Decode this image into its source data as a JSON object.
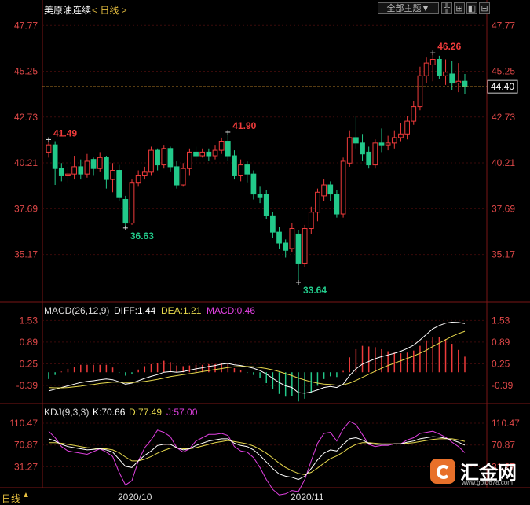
{
  "header": {
    "title": "美原油连续",
    "period": "< 日线 >",
    "theme_button": "全部主题▼"
  },
  "toolbar_buttons": [
    {
      "name": "crosshair-button",
      "glyph": "╬"
    },
    {
      "name": "zoom-in-button",
      "glyph": "⊞"
    },
    {
      "name": "prev-button",
      "glyph": "◧"
    },
    {
      "name": "next-button",
      "glyph": "⊟"
    }
  ],
  "colors": {
    "up": "#ef3b3b",
    "down": "#22c98a",
    "axis_text": "#e04848",
    "grid": "#3a0a0a",
    "diff_line": "#ffffff",
    "dea_line": "#e6d84c",
    "j_line": "#e040e0",
    "price_line": "#e8a030"
  },
  "footer": {
    "left_label": "日线",
    "x_labels": [
      "2020/10",
      "2020/11"
    ]
  },
  "logo": {
    "text": "汇金网",
    "url": "www.gold678.com"
  },
  "chart_data": [
    {
      "type": "candlestick",
      "name": "price",
      "y_ticks": [
        47.77,
        45.25,
        42.73,
        40.21,
        37.69,
        35.17
      ],
      "ylim": [
        32.6,
        48.3
      ],
      "current_price": 44.4,
      "annotations": [
        {
          "label": "41.49",
          "value": 41.49,
          "kind": "high",
          "index": 0
        },
        {
          "label": "36.63",
          "value": 36.63,
          "kind": "low",
          "index": 12
        },
        {
          "label": "41.90",
          "value": 41.9,
          "kind": "high",
          "index": 28
        },
        {
          "label": "33.64",
          "value": 33.64,
          "kind": "low",
          "index": 39
        },
        {
          "label": "46.26",
          "value": 46.26,
          "kind": "high",
          "index": 60
        }
      ],
      "candles": [
        [
          40.8,
          41.2,
          41.49,
          40.5
        ],
        [
          41.2,
          39.9,
          41.4,
          39.0
        ],
        [
          39.9,
          39.5,
          40.2,
          39.2
        ],
        [
          39.5,
          39.6,
          40.0,
          39.1
        ],
        [
          39.6,
          40.0,
          40.6,
          39.3
        ],
        [
          40.0,
          39.6,
          40.4,
          39.3
        ],
        [
          39.6,
          40.3,
          40.7,
          39.4
        ],
        [
          40.4,
          39.9,
          40.5,
          39.5
        ],
        [
          39.9,
          40.5,
          40.8,
          39.7
        ],
        [
          40.5,
          39.3,
          40.6,
          38.8
        ],
        [
          39.3,
          39.8,
          40.2,
          38.6
        ],
        [
          39.8,
          38.3,
          40.1,
          38.1
        ],
        [
          38.2,
          36.9,
          38.4,
          36.63
        ],
        [
          36.9,
          39.1,
          39.3,
          36.8
        ],
        [
          39.1,
          39.5,
          39.8,
          38.9
        ],
        [
          39.5,
          39.7,
          40.0,
          39.3
        ],
        [
          39.7,
          40.9,
          41.1,
          39.5
        ],
        [
          40.9,
          40.1,
          41.0,
          39.8
        ],
        [
          40.1,
          41.0,
          41.2,
          39.9
        ],
        [
          41.0,
          40.0,
          41.1,
          39.7
        ],
        [
          40.0,
          39.0,
          40.3,
          38.8
        ],
        [
          39.0,
          39.9,
          40.2,
          38.9
        ],
        [
          39.9,
          40.8,
          41.0,
          39.5
        ],
        [
          40.8,
          40.6,
          41.1,
          40.3
        ],
        [
          40.6,
          40.8,
          41.0,
          40.5
        ],
        [
          40.8,
          40.6,
          41.0,
          40.3
        ],
        [
          40.6,
          40.9,
          41.2,
          40.4
        ],
        [
          40.9,
          41.4,
          41.6,
          40.7
        ],
        [
          41.4,
          40.6,
          41.9,
          40.3
        ],
        [
          40.6,
          39.5,
          40.9,
          39.3
        ],
        [
          39.5,
          40.1,
          40.4,
          39.2
        ],
        [
          40.1,
          39.6,
          40.3,
          39.1
        ],
        [
          39.6,
          38.5,
          39.8,
          38.2
        ],
        [
          38.5,
          38.3,
          38.9,
          38.0
        ],
        [
          38.5,
          37.3,
          38.7,
          37.1
        ],
        [
          37.3,
          36.4,
          37.5,
          36.1
        ],
        [
          36.4,
          35.8,
          36.7,
          35.5
        ],
        [
          35.8,
          35.4,
          36.0,
          35.0
        ],
        [
          35.5,
          36.6,
          36.9,
          35.3
        ],
        [
          36.3,
          34.7,
          36.5,
          33.64
        ],
        [
          34.7,
          36.6,
          36.8,
          34.5
        ],
        [
          36.6,
          37.5,
          37.8,
          36.3
        ],
        [
          37.5,
          38.6,
          38.8,
          37.0
        ],
        [
          38.4,
          39.0,
          39.3,
          38.1
        ],
        [
          39.0,
          38.5,
          39.2,
          38.1
        ],
        [
          38.5,
          37.4,
          38.7,
          37.2
        ],
        [
          37.4,
          40.3,
          40.5,
          37.2
        ],
        [
          40.2,
          41.6,
          42.0,
          40.0
        ],
        [
          41.6,
          41.3,
          42.8,
          41.0
        ],
        [
          41.3,
          40.7,
          41.8,
          40.3
        ],
        [
          40.8,
          40.1,
          41.1,
          39.9
        ],
        [
          40.1,
          41.3,
          41.5,
          39.9
        ],
        [
          41.3,
          41.2,
          42.1,
          40.8
        ],
        [
          41.2,
          41.3,
          41.7,
          40.9
        ],
        [
          41.3,
          41.6,
          42.0,
          41.0
        ],
        [
          41.6,
          41.8,
          42.4,
          41.4
        ],
        [
          41.8,
          42.5,
          42.8,
          41.5
        ],
        [
          42.5,
          43.3,
          43.6,
          42.3
        ],
        [
          43.3,
          45.0,
          45.5,
          43.1
        ],
        [
          45.0,
          45.7,
          46.0,
          44.6
        ],
        [
          45.6,
          45.9,
          46.26,
          44.7
        ],
        [
          45.9,
          45.0,
          46.1,
          44.8
        ],
        [
          45.0,
          45.2,
          45.9,
          44.5
        ],
        [
          45.1,
          44.6,
          45.8,
          44.2
        ],
        [
          44.6,
          44.7,
          45.7,
          44.1
        ],
        [
          44.7,
          44.4,
          45.1,
          44.0
        ]
      ]
    },
    {
      "type": "line",
      "name": "macd",
      "label": "MACD(26,12,9)",
      "diff_label": "DIFF:1.44",
      "dea_label": "DEA:1.21",
      "macd_label": "MACD:0.46",
      "y_ticks": [
        1.53,
        0.89,
        0.25,
        -0.39
      ],
      "ylim": [
        -0.9,
        1.7
      ],
      "series": [
        {
          "key": "diff",
          "values": [
            -0.55,
            -0.5,
            -0.45,
            -0.4,
            -0.35,
            -0.3,
            -0.27,
            -0.25,
            -0.22,
            -0.2,
            -0.22,
            -0.28,
            -0.35,
            -0.32,
            -0.25,
            -0.18,
            -0.12,
            -0.07,
            0.0,
            0.02,
            0.0,
            0.02,
            0.06,
            0.1,
            0.13,
            0.17,
            0.2,
            0.24,
            0.26,
            0.22,
            0.2,
            0.16,
            0.12,
            0.05,
            -0.05,
            -0.18,
            -0.3,
            -0.4,
            -0.45,
            -0.6,
            -0.62,
            -0.58,
            -0.52,
            -0.45,
            -0.42,
            -0.45,
            -0.35,
            -0.1,
            0.1,
            0.24,
            0.32,
            0.4,
            0.46,
            0.51,
            0.56,
            0.62,
            0.7,
            0.8,
            0.95,
            1.12,
            1.28,
            1.38,
            1.45,
            1.48,
            1.47,
            1.44
          ]
        },
        {
          "key": "dea",
          "values": [
            -0.45,
            -0.46,
            -0.46,
            -0.45,
            -0.43,
            -0.41,
            -0.38,
            -0.36,
            -0.33,
            -0.31,
            -0.29,
            -0.29,
            -0.3,
            -0.3,
            -0.29,
            -0.27,
            -0.24,
            -0.21,
            -0.17,
            -0.13,
            -0.1,
            -0.07,
            -0.04,
            -0.01,
            0.02,
            0.05,
            0.08,
            0.11,
            0.14,
            0.16,
            0.17,
            0.17,
            0.16,
            0.14,
            0.11,
            0.07,
            0.02,
            -0.04,
            -0.1,
            -0.17,
            -0.23,
            -0.28,
            -0.32,
            -0.35,
            -0.36,
            -0.38,
            -0.37,
            -0.32,
            -0.24,
            -0.15,
            -0.06,
            0.03,
            0.12,
            0.2,
            0.27,
            0.34,
            0.41,
            0.48,
            0.56,
            0.65,
            0.76,
            0.86,
            0.96,
            1.06,
            1.14,
            1.21
          ]
        },
        {
          "key": "macd",
          "values": [
            -0.2,
            -0.08,
            0.02,
            0.1,
            0.16,
            0.22,
            0.22,
            0.22,
            0.22,
            0.22,
            0.14,
            -0.02,
            -0.1,
            -0.04,
            0.08,
            0.18,
            0.24,
            0.28,
            0.34,
            0.3,
            0.2,
            0.18,
            0.2,
            0.22,
            0.22,
            0.24,
            0.24,
            0.26,
            0.24,
            0.12,
            0.06,
            -0.02,
            -0.08,
            -0.18,
            -0.32,
            -0.5,
            -0.64,
            -0.72,
            -0.7,
            -0.86,
            -0.78,
            -0.6,
            -0.4,
            -0.2,
            -0.12,
            -0.14,
            0.04,
            0.44,
            0.68,
            0.78,
            0.76,
            0.74,
            0.68,
            0.62,
            0.58,
            0.56,
            0.58,
            0.64,
            0.78,
            0.94,
            1.04,
            1.04,
            0.98,
            0.84,
            0.66,
            0.46
          ]
        }
      ]
    },
    {
      "type": "line",
      "name": "kdj",
      "label": "KDJ(9,3,3)",
      "k_label": "K:70.66",
      "d_label": "D:77.49",
      "j_label": "J:57.00",
      "y_ticks": [
        110.47,
        70.87,
        31.27
      ],
      "ylim": [
        -4,
        122
      ],
      "series": [
        {
          "key": "k",
          "values": [
            82,
            78,
            72,
            68,
            66,
            64,
            62,
            63,
            64,
            62,
            58,
            45,
            32,
            30,
            42,
            52,
            60,
            70,
            72,
            72,
            66,
            62,
            64,
            70,
            74,
            78,
            80,
            82,
            82,
            74,
            70,
            68,
            62,
            52,
            40,
            28,
            18,
            14,
            12,
            8,
            14,
            28,
            44,
            56,
            62,
            60,
            72,
            82,
            84,
            80,
            74,
            72,
            72,
            72,
            73,
            73,
            76,
            78,
            82,
            84,
            86,
            85,
            83,
            80,
            76,
            70.66
          ]
        },
        {
          "key": "d",
          "values": [
            75,
            75,
            74,
            72,
            70,
            68,
            66,
            65,
            64,
            64,
            62,
            57,
            49,
            42,
            42,
            45,
            50,
            56,
            61,
            65,
            66,
            64,
            64,
            66,
            69,
            72,
            75,
            77,
            79,
            77,
            75,
            73,
            69,
            63,
            56,
            47,
            38,
            30,
            24,
            19,
            17,
            21,
            29,
            38,
            46,
            51,
            58,
            66,
            72,
            75,
            75,
            74,
            73,
            73,
            73,
            73,
            74,
            75,
            77,
            79,
            81,
            82,
            82,
            82,
            80,
            77.49
          ]
        },
        {
          "key": "j",
          "values": [
            96,
            84,
            68,
            60,
            58,
            56,
            54,
            59,
            64,
            58,
            50,
            21,
            -2,
            6,
            42,
            66,
            80,
            98,
            94,
            86,
            66,
            58,
            64,
            78,
            84,
            90,
            90,
            92,
            88,
            68,
            60,
            58,
            48,
            30,
            8,
            -10,
            -20,
            -18,
            -12,
            -14,
            8,
            42,
            74,
            92,
            94,
            78,
            100,
            114,
            108,
            90,
            72,
            68,
            70,
            70,
            73,
            73,
            80,
            84,
            92,
            94,
            96,
            91,
            85,
            76,
            68,
            57
          ]
        }
      ]
    }
  ]
}
